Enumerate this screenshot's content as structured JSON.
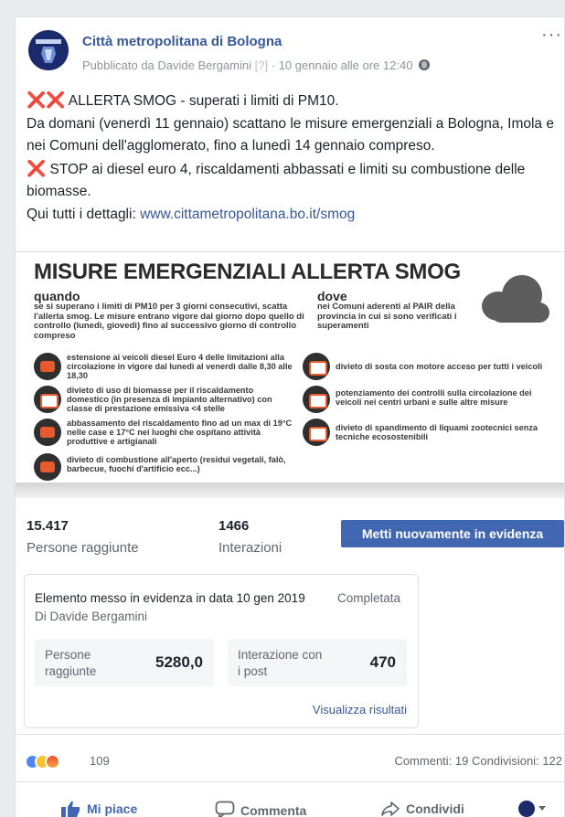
{
  "post": {
    "page_name": "Città metropolitana di Bologna",
    "meta": {
      "prefix": "Pubblicato da",
      "author": "Davide Bergamini",
      "bracket": "[?]",
      "sep": "·",
      "date": "10 gennaio alle ore 12:40"
    },
    "more": "···",
    "text": {
      "line1_icons": "❌❌",
      "line1": " ALLERTA SMOG - superati i limiti di PM10.",
      "line2": "Da domani (venerdì 11 gennaio) scattano le misure emergenziali a Bologna, Imola e nei Comuni dell'agglomerato, fino a lunedì 14 gennaio compreso.",
      "line3_icon": "❌",
      "line3": " STOP ai diesel euro 4, riscaldamenti abbassati e limiti su combustione delle biomasse.",
      "line4_prefix": "Qui tutti i dettagli: ",
      "link": "www.cittametropolitana.bo.it/smog"
    }
  },
  "infographic": {
    "title": "MISURE EMERGENZIALI ALLERTA SMOG",
    "quando_h": "quando",
    "quando_p": "se si superano i limiti di PM10 per 3 giorni consecutivi, scatta l'allerta smog. Le misure entrano vigore dal giorno dopo quello di controllo (lunedì, giovedì) fino al successivo giorno di controllo compreso",
    "dove_h": "dove",
    "dove_p": "nei Comuni aderenti al PAIR della provincia in cui si sono verificati i superamenti",
    "left_items": [
      "estensione ai veicoli diesel Euro 4 delle limitazioni alla circolazione in vigore dal lunedì al venerdì dalle 8,30 alle 18,30",
      "divieto di uso di biomasse per il riscaldamento domestico (in presenza di impianto alternativo) con classe di prestazione emissiva <4 stelle",
      "abbassamento del riscaldamento fino ad un max di 19°C nelle case e 17°C nei luoghi che ospitano attività produttive e artigianali",
      "divieto di combustione all'aperto (residui vegetali, falò, barbecue, fuochi d'artificio ecc...)"
    ],
    "right_items": [
      "divieto di sosta con motore acceso per tutti i veicoli",
      "potenziamento dei controlli sulla circolazione dei veicoli nei centri urbani e sulle altre misure",
      "divieto di spandimento di liquami zootecnici senza tecniche ecosostenibili"
    ]
  },
  "stats": {
    "reach_value": "15.417",
    "reach_label": "Persone raggiunte",
    "interactions_value": "1466",
    "interactions_label": "Interazioni",
    "boost_again": "Metti nuovamente in evidenza"
  },
  "boost": {
    "line1": "Elemento messo in evidenza in data 10 gen 2019",
    "status": "Completata",
    "by": "Di Davide Bergamini",
    "reach_label": "Persone raggiunte",
    "reach_value": "5280,0",
    "engagement_label": "Interazione con i post",
    "engagement_value": "470",
    "view_results": "Visualizza risultati"
  },
  "reactions": {
    "count": "109",
    "comments": "Commenti: 19",
    "shares": "Condivisioni: 122"
  },
  "actions": {
    "like": "Mi piace",
    "comment": "Commenta",
    "share": "Condividi"
  },
  "colors": {
    "link": "#365899",
    "button": "#4267b2",
    "alert_x": "#dd2e44"
  }
}
